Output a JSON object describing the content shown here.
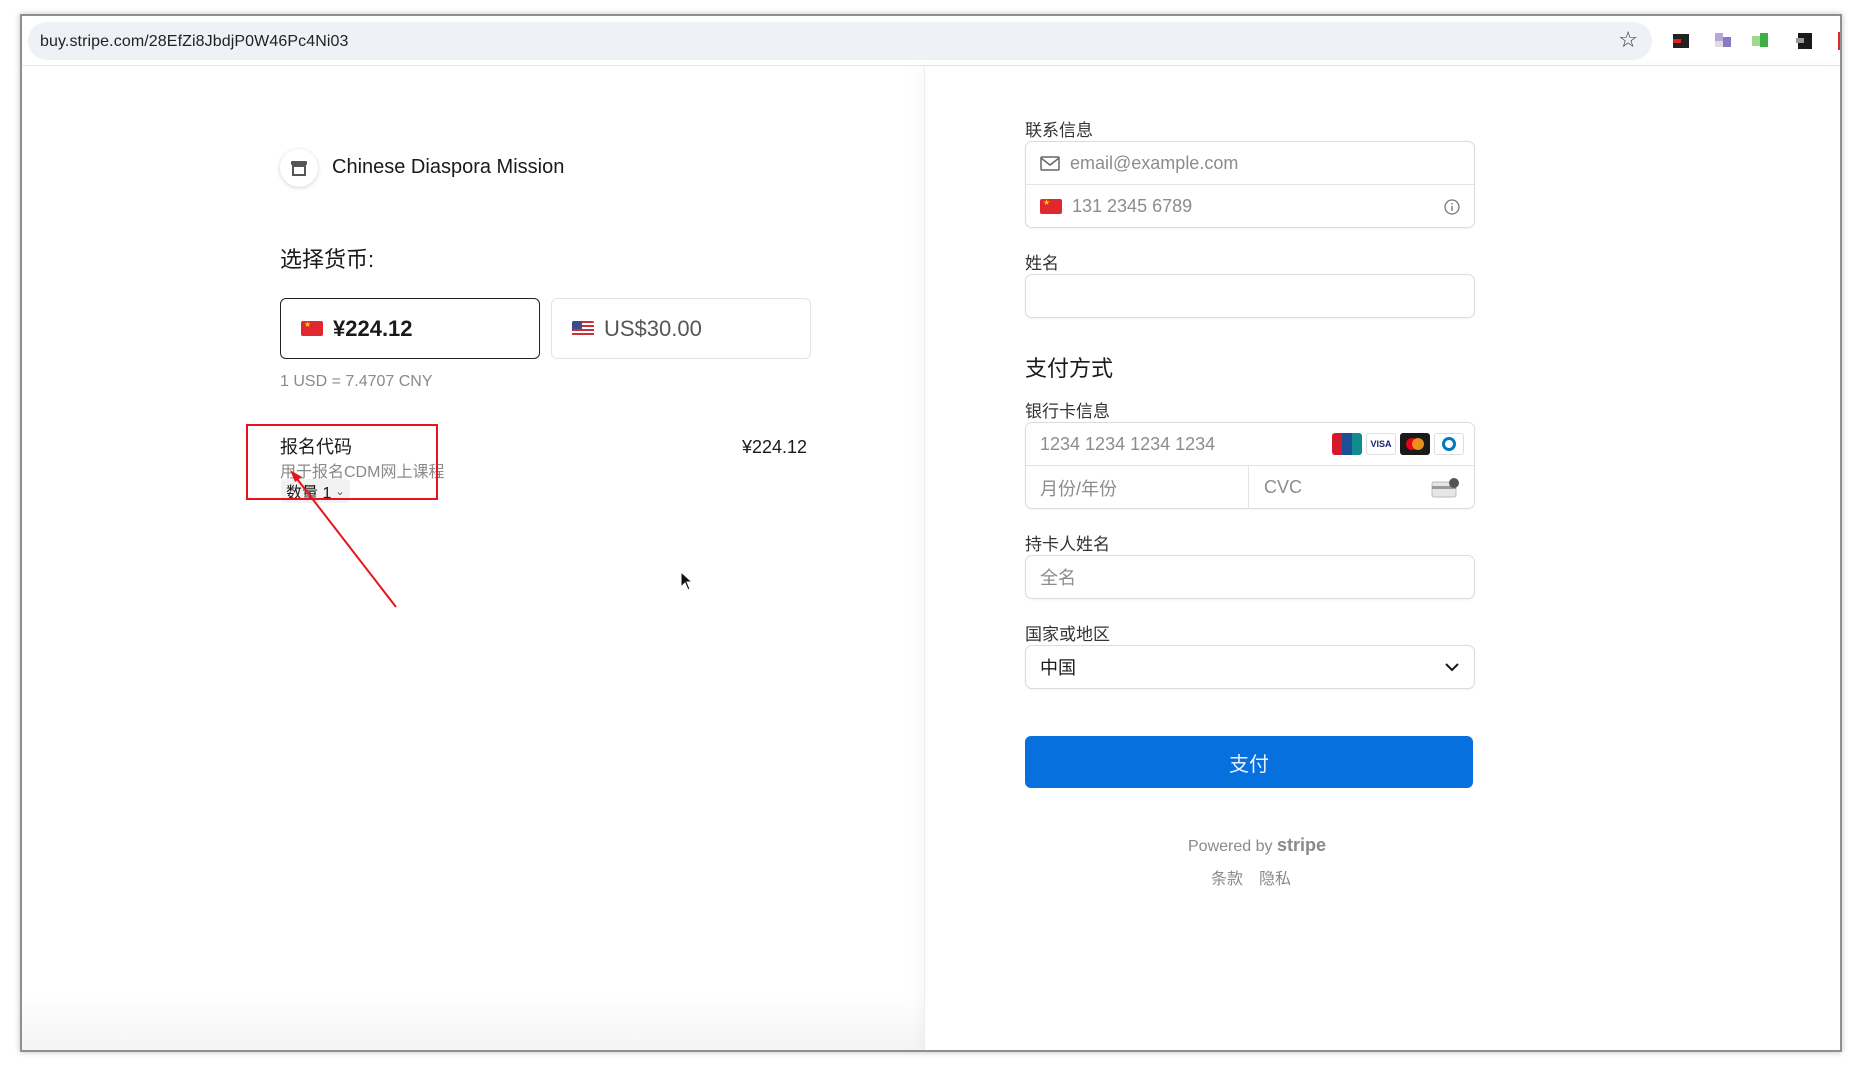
{
  "browser": {
    "url": "buy.stripe.com/28EfZi8JbdjP0W46Pc4Ni03"
  },
  "merchant": {
    "name": "Chinese Diaspora Mission"
  },
  "currency": {
    "heading": "选择货币:",
    "options": [
      {
        "label": "¥224.12",
        "selected": true
      },
      {
        "label": "US$30.00",
        "selected": false
      }
    ],
    "rate": "1 USD = 7.4707 CNY"
  },
  "line_item": {
    "name": "报名代码",
    "description": "用于报名CDM网上课程",
    "quantity_label": "数量 1",
    "price": "¥224.12"
  },
  "contact": {
    "label": "联系信息",
    "email_placeholder": "email@example.com",
    "phone_placeholder": "131 2345 6789"
  },
  "name_field": {
    "label": "姓名"
  },
  "payment": {
    "heading": "支付方式",
    "card_label": "银行卡信息",
    "card_number_placeholder": "1234 1234 1234 1234",
    "expiry_placeholder": "月份/年份",
    "cvc_placeholder": "CVC",
    "card_brands": [
      "UnionPay",
      "VISA",
      "Mastercard",
      "Diners"
    ]
  },
  "cardholder": {
    "label": "持卡人姓名",
    "placeholder": "全名"
  },
  "country": {
    "label": "国家或地区",
    "selected": "中国"
  },
  "pay_button": "支付",
  "footer": {
    "powered_prefix": "Powered by",
    "powered_brand": "stripe",
    "terms": "条款",
    "privacy": "隐私"
  },
  "colors": {
    "pay_button": "#0570de",
    "highlight": "#e8141b"
  }
}
